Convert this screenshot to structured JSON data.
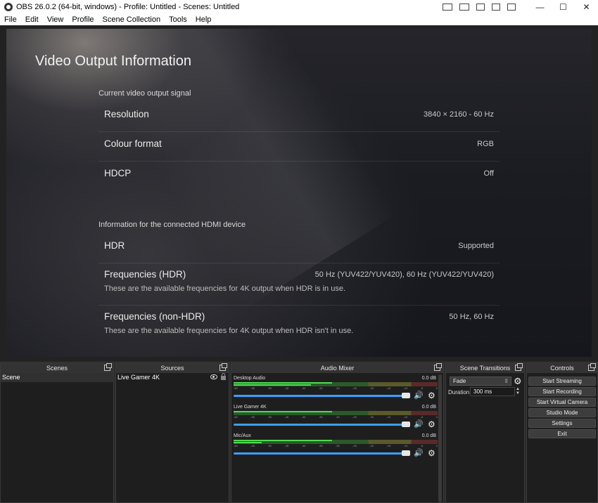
{
  "window": {
    "title": "OBS 26.0.2 (64-bit, windows) - Profile: Untitled - Scenes: Untitled",
    "minimize": "—",
    "maximize": "☐",
    "close": "✕"
  },
  "menu": [
    "File",
    "Edit",
    "View",
    "Profile",
    "Scene Collection",
    "Tools",
    "Help"
  ],
  "preview": {
    "title": "Video Output Information",
    "section1": "Current video output signal",
    "rows1": [
      {
        "label": "Resolution",
        "value": "3840 × 2160 - 60 Hz"
      },
      {
        "label": "Colour format",
        "value": "RGB"
      },
      {
        "label": "HDCP",
        "value": "Off"
      }
    ],
    "section2": "Information for the connected HDMI device",
    "rows2": [
      {
        "label": "HDR",
        "value": "Supported",
        "sub": ""
      },
      {
        "label": "Frequencies (HDR)",
        "value": "50 Hz (YUV422/YUV420), 60 Hz (YUV422/YUV420)",
        "sub": "These are the available frequencies for 4K output when HDR is in use."
      },
      {
        "label": "Frequencies (non-HDR)",
        "value": "50 Hz, 60 Hz",
        "sub": "These are the available frequencies for 4K output when HDR isn't in use."
      }
    ]
  },
  "docks": {
    "scenes": {
      "title": "Scenes",
      "items": [
        "Scene"
      ]
    },
    "sources": {
      "title": "Sources",
      "items": [
        "Live Gamer 4K"
      ]
    },
    "mixer": {
      "title": "Audio Mixer",
      "channels": [
        {
          "name": "Desktop Audio",
          "db": "0.0 dB"
        },
        {
          "name": "Live Gamer 4K",
          "db": "0.0 dB"
        },
        {
          "name": "Mic/Aux",
          "db": "0.0 dB"
        }
      ],
      "ticks": [
        "-60",
        "-55",
        "-50",
        "-45",
        "-40",
        "-35",
        "-30",
        "-25",
        "-20",
        "-15",
        "-10",
        "-5",
        "0"
      ]
    },
    "transitions": {
      "title": "Scene Transitions",
      "selected": "Fade",
      "duration_label": "Duration",
      "duration_value": "300 ms"
    },
    "controls": {
      "title": "Controls",
      "buttons": [
        "Start Streaming",
        "Start Recording",
        "Start Virtual Camera",
        "Studio Mode",
        "Settings",
        "Exit"
      ]
    }
  }
}
